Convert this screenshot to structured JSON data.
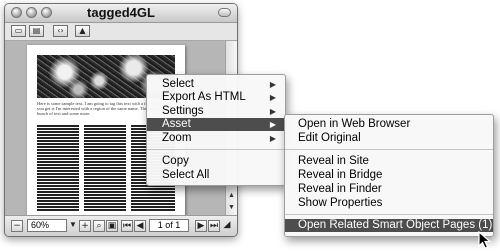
{
  "window": {
    "title": "tagged4GL",
    "toolbar_icons": [
      "page-view-icon",
      "layout-view-icon",
      "source-view-icon",
      "image-view-icon"
    ]
  },
  "document_preview": {
    "intro_text": "Here is some sample text. I am going to tag this text with a few tags. What you get is I'm interested with a region of the same name. Then type up a bunch of text and some more."
  },
  "statusbar": {
    "zoom_value": "60%",
    "page_indicator": "1 of 1"
  },
  "context_menu": {
    "items": [
      {
        "label": "Select",
        "submenu": true
      },
      {
        "label": "Export As HTML",
        "submenu": true
      },
      {
        "label": "Settings",
        "submenu": true
      },
      {
        "label": "Asset",
        "submenu": true,
        "highlighted": true
      },
      {
        "label": "Zoom",
        "submenu": true
      },
      {
        "label": "Copy",
        "submenu": false
      },
      {
        "label": "Select All",
        "submenu": false
      }
    ]
  },
  "asset_submenu": {
    "items": [
      {
        "label": "Open in Web Browser"
      },
      {
        "label": "Edit Original"
      },
      {
        "label": "Reveal in Site"
      },
      {
        "label": "Reveal in Bridge"
      },
      {
        "label": "Reveal in Finder"
      },
      {
        "label": "Show Properties"
      },
      {
        "label": "Open Related Smart Object Pages (1)",
        "highlighted": true
      }
    ]
  },
  "colors": {
    "menu_highlight": "#4d4d4d",
    "preview_background": "#b6b6b6"
  }
}
